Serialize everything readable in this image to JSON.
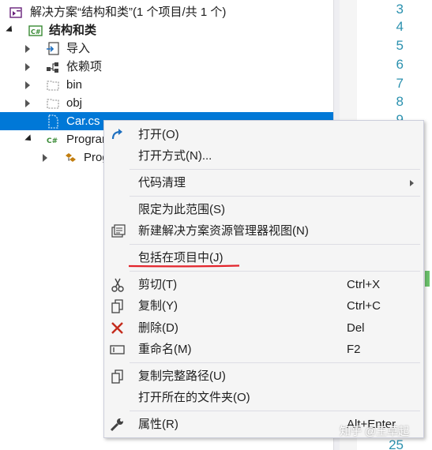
{
  "tree": {
    "solution": "解决方案“结构和类”(1 个项目/共 1 个)",
    "project": "结构和类",
    "items": [
      {
        "label": "导入",
        "icon": "import-icon"
      },
      {
        "label": "依赖项",
        "icon": "dependencies-icon"
      },
      {
        "label": "bin",
        "icon": "folder-icon"
      },
      {
        "label": "obj",
        "icon": "folder-icon"
      },
      {
        "label": "Car.cs",
        "icon": "csharp-file-icon"
      },
      {
        "label": "Program.cs",
        "icon": "csharp-file-icon"
      },
      {
        "label": "Program",
        "icon": "class-icon"
      }
    ]
  },
  "editor": {
    "line_numbers": [
      "3",
      "4",
      "5",
      "6",
      "7",
      "8",
      "9",
      "25"
    ]
  },
  "context_menu": {
    "open": {
      "label": "打开(O)",
      "icon": "open-arrow-icon"
    },
    "open_with": {
      "label": "打开方式(N)..."
    },
    "code_cleanup": {
      "label": "代码清理",
      "has_submenu": true
    },
    "scope_to_this": {
      "label": "限定为此范围(S)"
    },
    "new_view": {
      "label": "新建解决方案资源管理器视图(N)",
      "icon": "new-view-icon"
    },
    "include_in_project": {
      "label": "包括在项目中(J)"
    },
    "cut": {
      "label": "剪切(T)",
      "shortcut": "Ctrl+X",
      "icon": "scissors-icon"
    },
    "copy": {
      "label": "复制(Y)",
      "shortcut": "Ctrl+C",
      "icon": "copy-icon"
    },
    "delete": {
      "label": "删除(D)",
      "shortcut": "Del",
      "icon": "delete-x-icon"
    },
    "rename": {
      "label": "重命名(M)",
      "shortcut": "F2",
      "icon": "rename-icon"
    },
    "copy_full_path": {
      "label": "复制完整路径(U)",
      "icon": "copy-path-icon"
    },
    "open_folder": {
      "label": "打开所在的文件夹(O)"
    },
    "properties": {
      "label": "属性(R)",
      "shortcut": "Alt+Enter",
      "icon": "wrench-icon"
    }
  },
  "colors": {
    "selection": "#0078d7",
    "menu_bg": "#f5f5f5",
    "delete_red": "#c42b1c",
    "annotation_red": "#e3242b",
    "line_number": "#2b91af"
  },
  "watermark": "知乎 @王草起"
}
